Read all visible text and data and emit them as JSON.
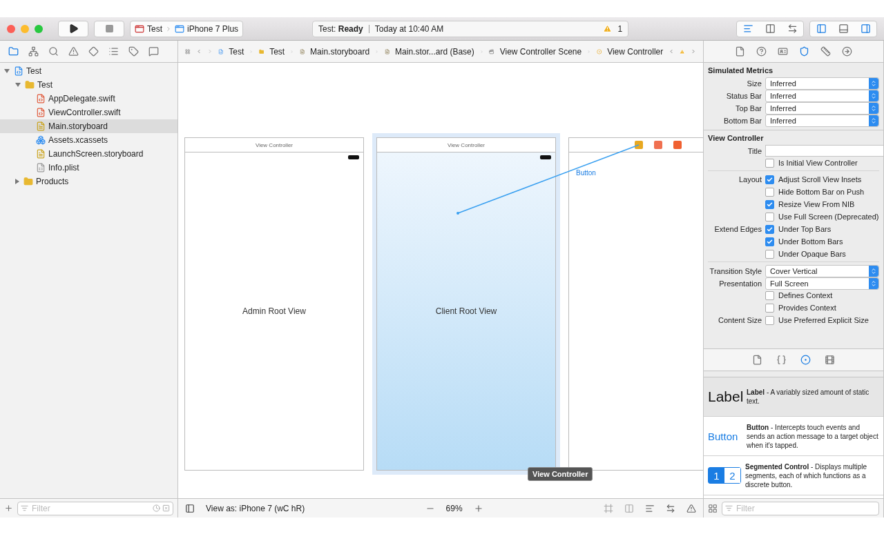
{
  "toolbar": {
    "scheme": "Test",
    "device": "iPhone 7 Plus",
    "status": "Test: **Ready**",
    "time": "Today at 10:40 AM",
    "warnings": "1",
    "editor_modes": [
      {
        "kind": "standard",
        "selected": true
      },
      {
        "kind": "assistant",
        "selected": false
      },
      {
        "kind": "version",
        "selected": false
      }
    ],
    "panels": [
      {
        "kind": "left",
        "on": true
      },
      {
        "kind": "bottom",
        "on": false
      },
      {
        "kind": "right",
        "on": true
      }
    ]
  },
  "navigator_tabs": [
    {
      "kind": "folder",
      "selected": true
    },
    {
      "kind": "hierarchy",
      "selected": false
    },
    {
      "kind": "search",
      "selected": false
    },
    {
      "kind": "warning",
      "selected": false
    },
    {
      "kind": "test",
      "selected": false
    },
    {
      "kind": "debug",
      "selected": false
    },
    {
      "kind": "breakpoint",
      "selected": false
    },
    {
      "kind": "report",
      "selected": false
    }
  ],
  "navigator_tree": [
    {
      "name": "Test",
      "kind": "project",
      "expanded": true,
      "selected": false,
      "children": [
        {
          "name": "Test",
          "kind": "folder",
          "expanded": true,
          "selected": false,
          "children": [
            {
              "name": "AppDelegate.swift",
              "kind": "swift",
              "selected": false
            },
            {
              "name": "ViewController.swift",
              "kind": "swift",
              "selected": false
            },
            {
              "name": "Main.storyboard",
              "kind": "storyboard",
              "selected": true
            },
            {
              "name": "Assets.xcassets",
              "kind": "assets",
              "selected": false
            },
            {
              "name": "LaunchScreen.storyboard",
              "kind": "storyboard",
              "selected": false
            },
            {
              "name": "Info.plist",
              "kind": "plist",
              "selected": false
            }
          ]
        },
        {
          "name": "Products",
          "kind": "folder",
          "expanded": false,
          "selected": false
        }
      ]
    }
  ],
  "navigator_filter": {
    "placeholder": "Filter"
  },
  "jump_bar": [
    {
      "kind": "project",
      "text": "Test"
    },
    {
      "kind": "folder",
      "text": "Test"
    },
    {
      "kind": "storyboard",
      "text": "Main.storyboard"
    },
    {
      "kind": "storyboard",
      "text": "Main.stor...ard (Base)"
    },
    {
      "kind": "scene",
      "text": "View Controller Scene"
    },
    {
      "kind": "controller",
      "text": "View Controller"
    }
  ],
  "canvas": {
    "scenes": [
      {
        "title": "View Controller",
        "label": "Admin Root View",
        "selected": false
      },
      {
        "title": "View Controller",
        "label": "Client Root View",
        "selected": true
      },
      {
        "button": "Button",
        "selected": false
      }
    ],
    "tooltip": "View Controller"
  },
  "editor_bottom": {
    "view_as": "View as: iPhone 7 (wC hR)",
    "zoom": "69%"
  },
  "inspector_tabs": [
    {
      "kind": "file",
      "selected": false
    },
    {
      "kind": "help",
      "selected": false
    },
    {
      "kind": "identity",
      "selected": false
    },
    {
      "kind": "attributes",
      "selected": true
    },
    {
      "kind": "size",
      "selected": false
    },
    {
      "kind": "connections",
      "selected": false
    }
  ],
  "simulated_metrics": {
    "heading": "Simulated Metrics",
    "fields": [
      {
        "label": "Size",
        "value": "Inferred"
      },
      {
        "label": "Status Bar",
        "value": "Inferred"
      },
      {
        "label": "Top Bar",
        "value": "Inferred"
      },
      {
        "label": "Bottom Bar",
        "value": "Inferred"
      }
    ]
  },
  "view_controller": {
    "heading": "View Controller",
    "title_label": "Title",
    "groups": [
      [
        {
          "text": "Is Initial View Controller",
          "checked": false
        }
      ],
      [
        {
          "label": "Layout",
          "text": "Adjust Scroll View Insets",
          "checked": true
        },
        {
          "text": "Hide Bottom Bar on Push",
          "checked": false
        },
        {
          "text": "Resize View From NIB",
          "checked": true
        },
        {
          "text": "Use Full Screen (Deprecated)",
          "checked": false
        },
        {
          "label": "Extend Edges",
          "text": "Under Top Bars",
          "checked": true
        },
        {
          "text": "Under Bottom Bars",
          "checked": true
        },
        {
          "text": "Under Opaque Bars",
          "checked": false
        }
      ]
    ],
    "popups": [
      {
        "label": "Transition Style",
        "value": "Cover Vertical"
      },
      {
        "label": "Presentation",
        "value": "Full Screen"
      }
    ],
    "more": [
      {
        "text": "Defines Context",
        "checked": false
      },
      {
        "text": "Provides Context",
        "checked": false
      },
      {
        "label": "Content Size",
        "text": "Use Preferred Explicit Size",
        "checked": false
      }
    ]
  },
  "library_tabs": [
    {
      "kind": "file",
      "selected": false
    },
    {
      "kind": "code",
      "selected": false
    },
    {
      "kind": "object",
      "selected": true
    },
    {
      "kind": "media",
      "selected": false
    }
  ],
  "library": [
    {
      "kind": "label",
      "preview": "Label",
      "description": "**Label** - A variably sized amount of static text.",
      "selected": true
    },
    {
      "kind": "button",
      "preview": "Button",
      "description": "**Button** - Intercepts touch events and sends an action message to a target object when it's tapped.",
      "selected": false
    },
    {
      "kind": "segmented",
      "segments": [
        "1",
        "2"
      ],
      "description": "**Segmented Control** - Displays multiple segments, each of which functions as a discrete button.",
      "selected": false
    }
  ],
  "library_filter": {
    "placeholder": "Filter"
  }
}
